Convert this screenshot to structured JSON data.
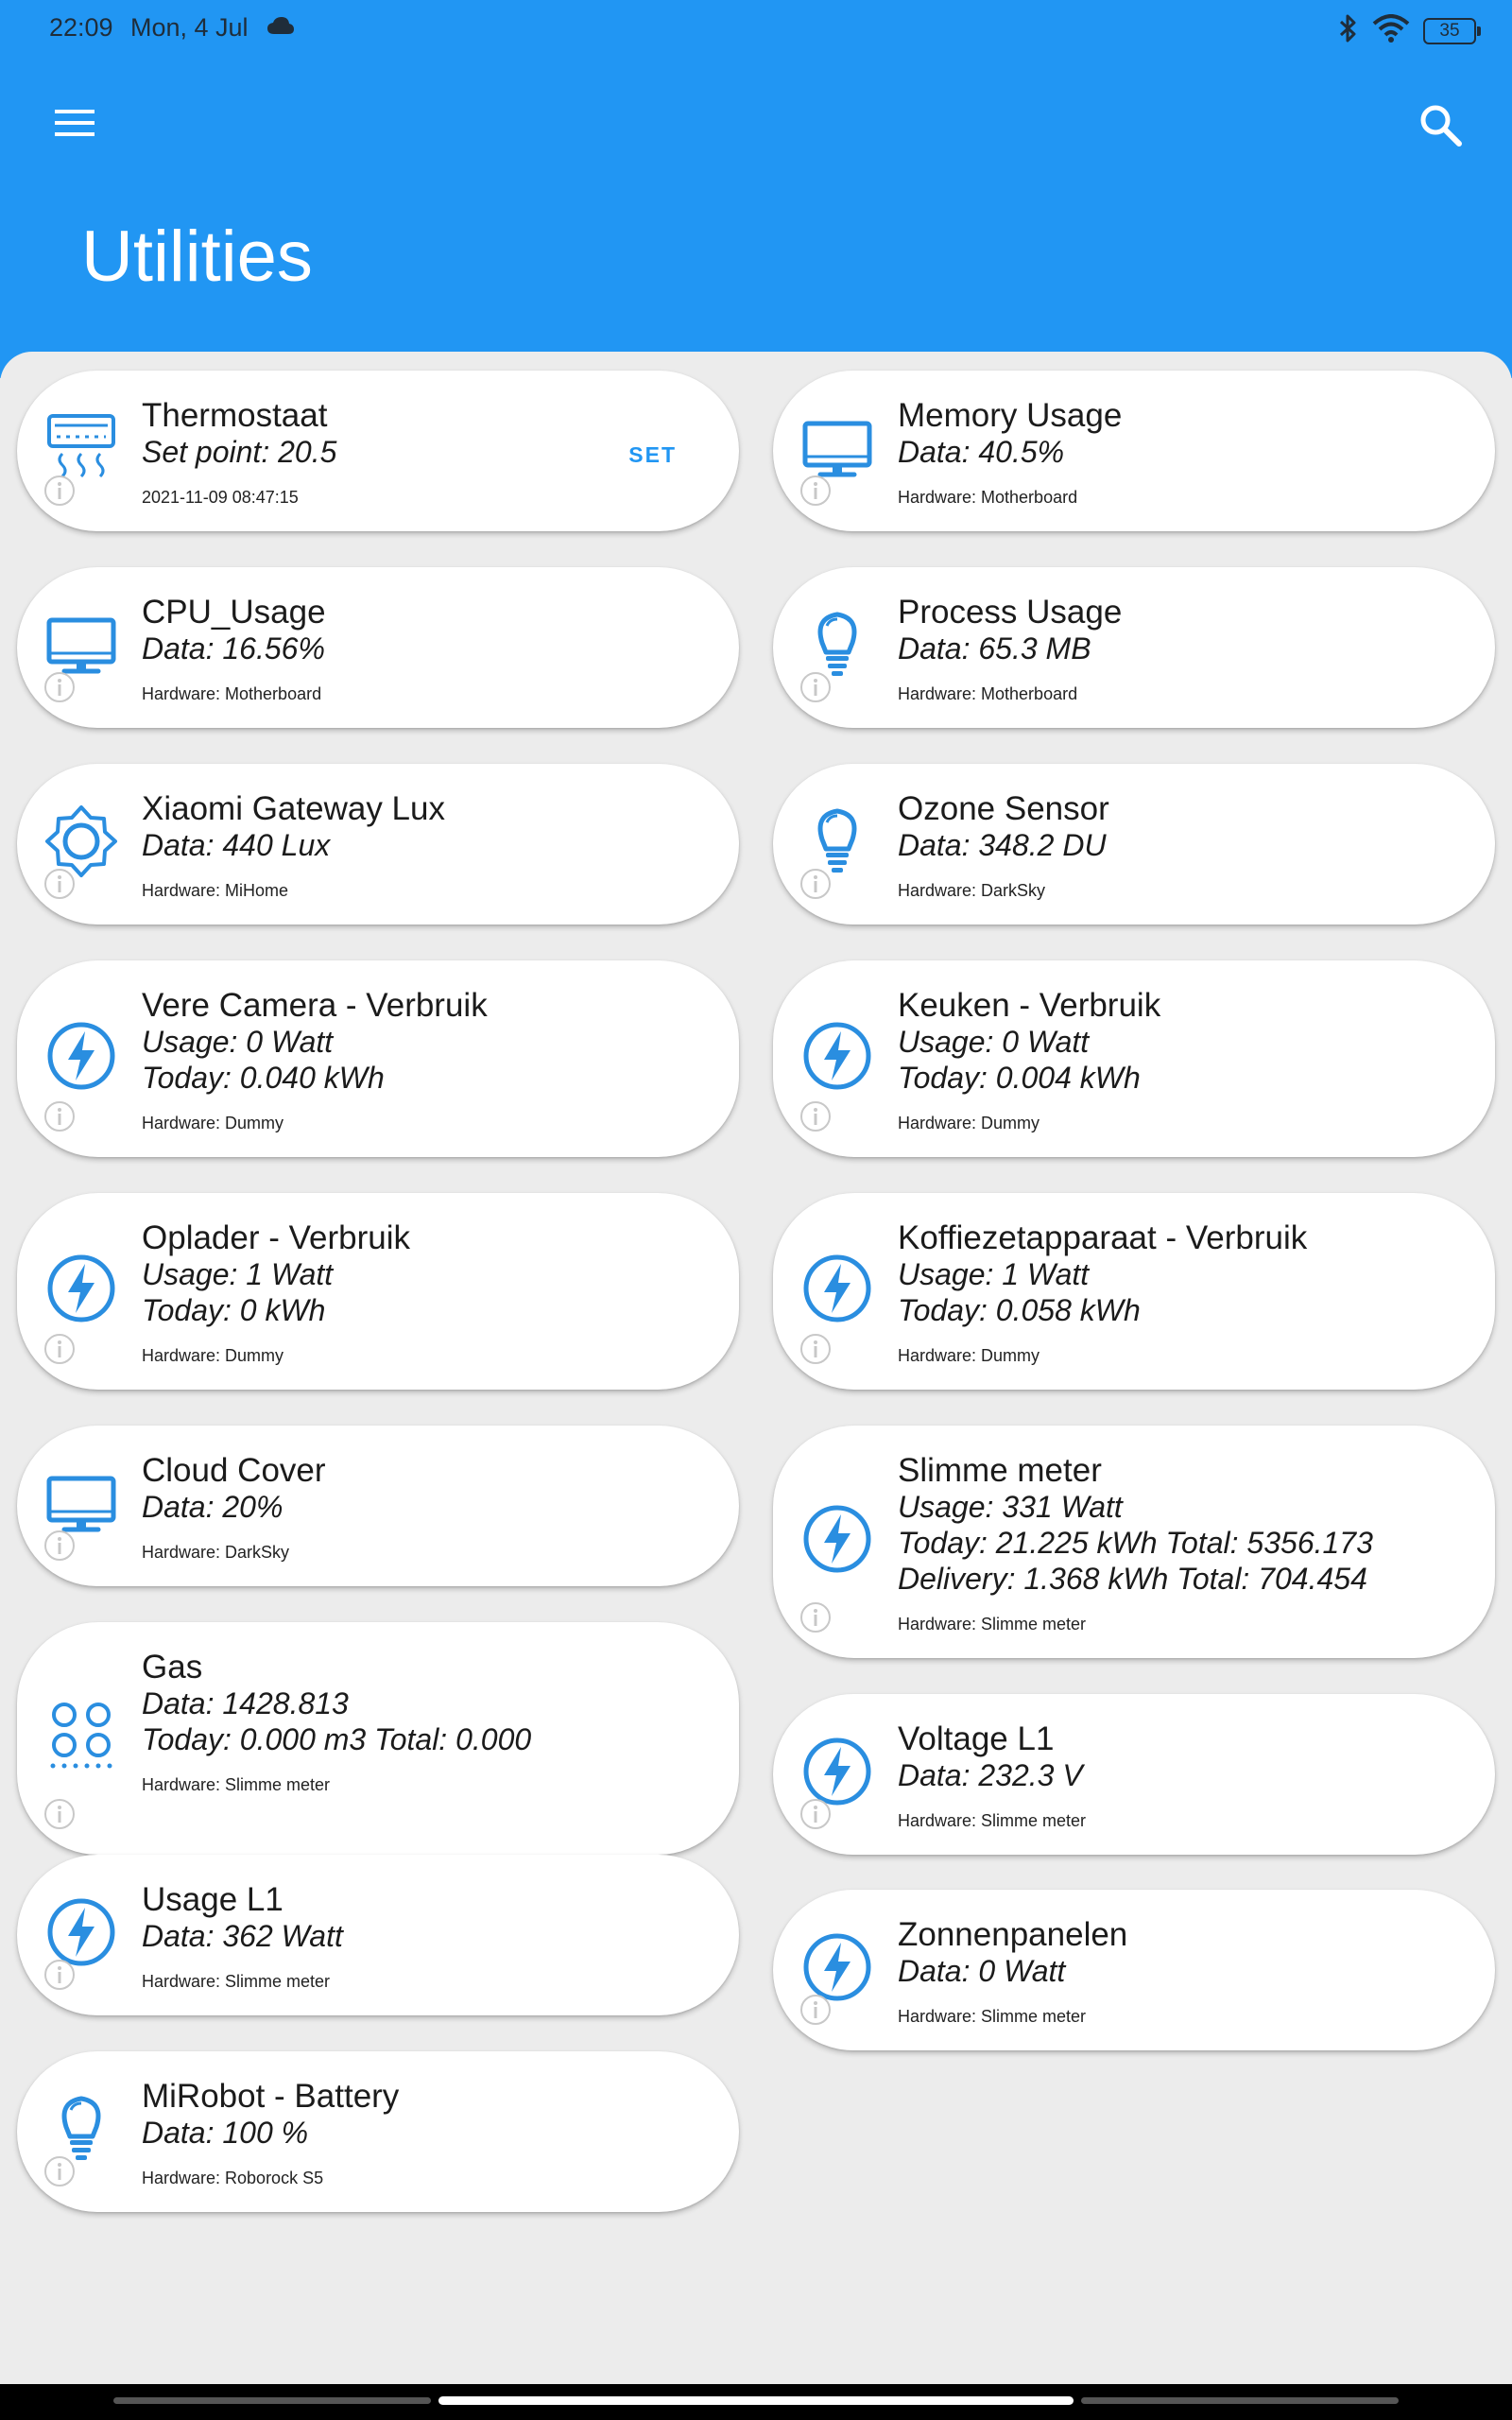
{
  "status_bar": {
    "time": "22:09",
    "date": "Mon, 4 Jul",
    "battery": "35"
  },
  "app_bar": {
    "title": "Utilities"
  },
  "colors": {
    "accent": "#2196f3",
    "icon": "#2a8ee0",
    "info": "#c8c8c8"
  },
  "devices": [
    {
      "name": "Thermostaat",
      "icon": "airco-icon",
      "lines": [
        "Set point: 20.5"
      ],
      "footer": "2021-11-09 08:47:15",
      "action": "SET"
    },
    {
      "name": "Memory Usage",
      "icon": "monitor-icon",
      "lines": [
        "Data: 40.5%"
      ],
      "footer": "Hardware: Motherboard"
    },
    {
      "name": "CPU_Usage",
      "icon": "monitor-icon",
      "lines": [
        "Data: 16.56%"
      ],
      "footer": "Hardware: Motherboard"
    },
    {
      "name": "Process Usage",
      "icon": "bulb-icon",
      "lines": [
        "Data: 65.3 MB"
      ],
      "footer": "Hardware: Motherboard"
    },
    {
      "name": "Xiaomi Gateway Lux",
      "icon": "lux-icon",
      "lines": [
        "Data: 440 Lux"
      ],
      "footer": "Hardware: MiHome"
    },
    {
      "name": "Ozone Sensor",
      "icon": "bulb-icon",
      "lines": [
        "Data: 348.2 DU"
      ],
      "footer": "Hardware: DarkSky"
    },
    {
      "name": "Vere Camera - Verbruik",
      "icon": "power-icon",
      "lines": [
        "Usage: 0 Watt",
        "Today: 0.040 kWh"
      ],
      "footer": "Hardware: Dummy"
    },
    {
      "name": "Keuken - Verbruik",
      "icon": "power-icon",
      "lines": [
        "Usage: 0 Watt",
        "Today: 0.004 kWh"
      ],
      "footer": "Hardware: Dummy"
    },
    {
      "name": "Oplader - Verbruik",
      "icon": "power-icon",
      "lines": [
        "Usage: 1 Watt",
        "Today: 0 kWh"
      ],
      "footer": "Hardware: Dummy"
    },
    {
      "name": "Koffiezetapparaat - Verbruik",
      "icon": "power-icon",
      "lines": [
        "Usage: 1 Watt",
        "Today: 0.058 kWh"
      ],
      "footer": "Hardware: Dummy"
    },
    {
      "name": "Cloud Cover",
      "icon": "monitor-icon",
      "lines": [
        "Data: 20%"
      ],
      "footer": "Hardware: DarkSky"
    },
    {
      "name": "Slimme meter",
      "icon": "power-icon",
      "lines": [
        "Usage: 331 Watt",
        "Today: 21.225 kWh Total: 5356.173",
        "Delivery: 1.368 kWh Total: 704.454"
      ],
      "footer": "Hardware: Slimme meter"
    },
    {
      "name": "Gas",
      "icon": "gas-icon",
      "lines": [
        "Data: 1428.813",
        "Today: 0.000 m3 Total: 0.000"
      ],
      "footer": "Hardware: Slimme meter"
    },
    {
      "name": "Voltage L1",
      "icon": "power-icon",
      "lines": [
        "Data: 232.3 V"
      ],
      "footer": "Hardware: Slimme meter"
    },
    {
      "name": "Usage L1",
      "icon": "power-icon",
      "lines": [
        "Data: 362 Watt"
      ],
      "footer": "Hardware: Slimme meter"
    },
    {
      "name": "Zonnenpanelen",
      "icon": "power-icon",
      "lines": [
        "Data: 0 Watt"
      ],
      "footer": "Hardware: Slimme meter"
    },
    {
      "name": "MiRobot - Battery",
      "icon": "bulb-icon",
      "lines": [
        "Data: 100 %"
      ],
      "footer": "Hardware: Roborock S5"
    }
  ]
}
